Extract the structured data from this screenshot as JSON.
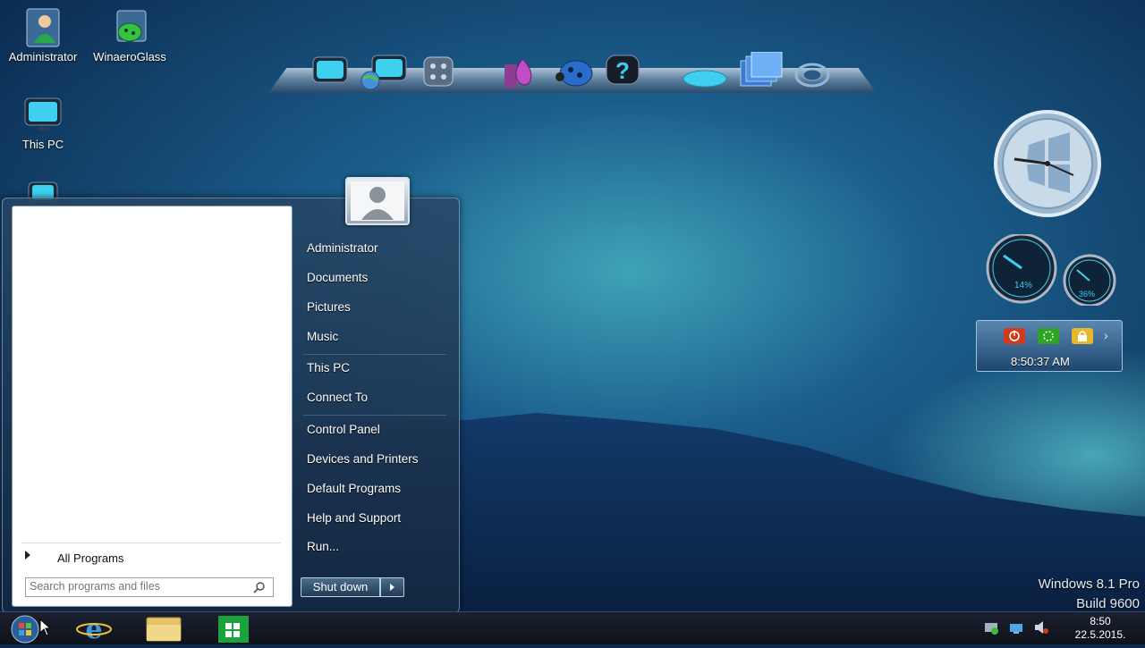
{
  "desktop": {
    "icons": [
      {
        "label": "Administrator"
      },
      {
        "label": "WinaeroGlass"
      },
      {
        "label": "This PC"
      }
    ]
  },
  "start_menu": {
    "all_programs": "All Programs",
    "search_placeholder": "Search programs and files",
    "right_items": [
      "Administrator",
      "Documents",
      "Pictures",
      "Music",
      "This PC",
      "Connect To",
      "Control Panel",
      "Devices and Printers",
      "Default Programs",
      "Help and Support",
      "Run..."
    ],
    "shutdown": "Shut down"
  },
  "gadgets": {
    "time": "8:50:37 AM",
    "cpu_percent": "14%",
    "ram_percent": "36%"
  },
  "watermark": {
    "line1": "Windows 8.1 Pro",
    "line2": "Build 9600"
  },
  "taskbar": {
    "clock_time": "8:50",
    "clock_date": "22.5.2015."
  },
  "colors": {
    "accent": "#3fd0f0",
    "taskbar": "#121722"
  }
}
